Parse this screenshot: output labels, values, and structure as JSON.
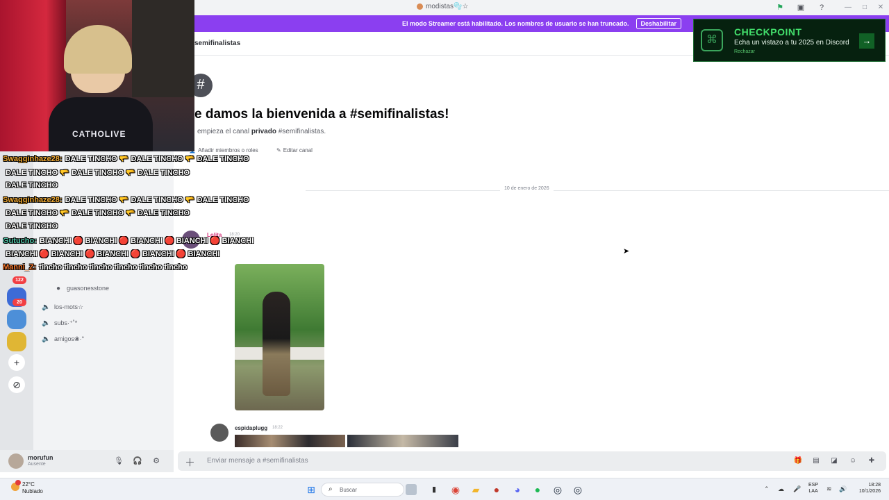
{
  "window": {
    "title": "modistas🫧☆"
  },
  "banner": {
    "message": "El modo Streamer está habilitado. Los nombres de usuario se han truncado.",
    "button": "Deshabilitar"
  },
  "header": {
    "channel": "semifinalistas"
  },
  "checkpoint": {
    "title": "CHECKPOINT",
    "subtitle": "Echa un vistazo a tu 2025 en Discord",
    "dismiss": "Rechazar"
  },
  "webcam": {
    "shirt_text": "CATHOLIVE"
  },
  "chat_overlay": [
    {
      "user": "Swagginhaze28:",
      "user_color": "#f0a830",
      "text": "DALE TINCHO 🫳 DALE TINCHO 🫳 DALE TINCHO"
    },
    {
      "user": "",
      "user_color": "#ffffff",
      "text": "DALE TINCHO 🫳 DALE TINCHO 🫳 DALE TINCHO"
    },
    {
      "user": "",
      "user_color": "#ffffff",
      "text": "DALE TINCHO"
    },
    {
      "user": "Swagginhaze28:",
      "user_color": "#f0a830",
      "text": "DALE TINCHO 🫳 DALE TINCHO 🫳 DALE TINCHO"
    },
    {
      "user": "",
      "user_color": "#ffffff",
      "text": "DALE TINCHO 🫳 DALE TINCHO 🫳 DALE TINCHO"
    },
    {
      "user": "",
      "user_color": "#ffffff",
      "text": "DALE TINCHO"
    },
    {
      "user": "Gutucho:",
      "user_color": "#4fc6a8",
      "text": "BIANCHI 🔴 BIANCHI 🔴 BIANCHI 🔴 BIANCHI 🔴 BIANCHI"
    },
    {
      "user": "",
      "user_color": "#ffffff",
      "text": "BIANCHI 🔴 BIANCHI 🔴 BIANCHI 🔴 BIANCHI 🔴 BIANCHI"
    },
    {
      "user": "Manni_Z:",
      "user_color": "#ff7b2e",
      "text": "tincho tincho tincho tincho tincho tincho"
    }
  ],
  "sidebar": {
    "voice_user": "guasonesstone",
    "channels": [
      {
        "icon": "speaker-icon",
        "label": "los-mots☆"
      },
      {
        "icon": "speaker-icon",
        "label": "subs·⁺˚*"
      },
      {
        "icon": "speaker-icon",
        "label": "amigos❀·°"
      }
    ],
    "server_badges": [
      "122",
      "20"
    ],
    "server_colors": [
      "#3d6bd6",
      "#4d8fd8",
      "#e0b634"
    ]
  },
  "welcome": {
    "title": "e damos la bienvenida a #semifinalistas!",
    "subtitle_pre": "empieza el canal ",
    "subtitle_bold": "privado",
    "subtitle_post": " #semifinalistas.",
    "add_members": "Añadir miembros o roles",
    "edit_channel": "Editar canal"
  },
  "divider": {
    "date": "10 de enero de 2026"
  },
  "messages": [
    {
      "author": "Lolita",
      "time": "18:20"
    },
    {
      "author": "espidaplugg",
      "time": "18:22"
    }
  ],
  "composer": {
    "placeholder": "Enviar mensaje a #semifinalistas"
  },
  "user_panel": {
    "name": "morufun",
    "status": "Ausente"
  },
  "taskbar": {
    "weather_temp": "22°C",
    "weather_cond": "Nublado",
    "search": "Buscar",
    "lang_top": "ESP",
    "lang_bottom": "LAA",
    "time": "18:28",
    "date": "10/1/2026"
  }
}
